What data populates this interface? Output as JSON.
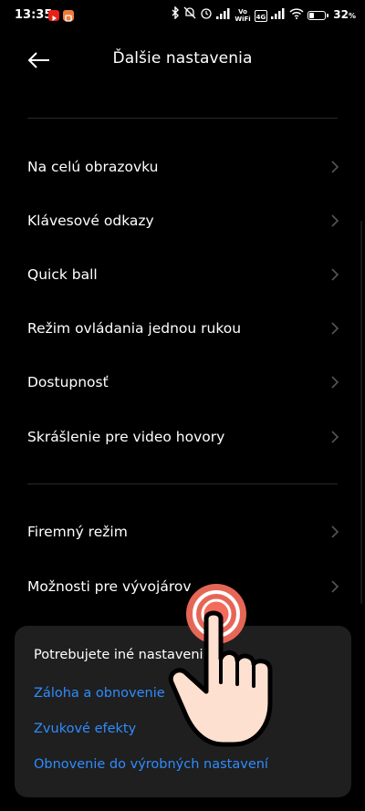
{
  "status_bar": {
    "time": "13:35",
    "network_vo": "Vo",
    "network_wifi": "WiFi",
    "lte_badge": "4G",
    "battery_percent": "32",
    "battery_unit": "%",
    "icons": [
      "youtube-app-icon",
      "app-notification-icon",
      "bluetooth-icon",
      "do-not-disturb-icon",
      "alarm-icon",
      "signal-icon",
      "vowifi-icon",
      "lte-icon",
      "signal-icon",
      "wifi-icon",
      "battery-icon"
    ]
  },
  "header": {
    "title": "Ďalšie nastavenia",
    "back_icon": "back-arrow-icon"
  },
  "list_group_1": {
    "items": [
      {
        "label": "Na celú obrazovku"
      },
      {
        "label": "Klávesové odkazy"
      },
      {
        "label": "Quick ball"
      },
      {
        "label": "Režim ovládania jednou rukou"
      },
      {
        "label": "Dostupnosť"
      },
      {
        "label": "Skrášlenie pre video hovory"
      }
    ]
  },
  "list_group_2": {
    "items": [
      {
        "label": "Firemný režim"
      },
      {
        "label": "Možnosti pre vývojárov"
      }
    ]
  },
  "help_card": {
    "title": "Potrebujete iné nastavenia?",
    "links": [
      {
        "label": "Záloha a obnovenie"
      },
      {
        "label": "Zvukové efekty"
      },
      {
        "label": "Obnovenie do výrobných nastavení"
      }
    ]
  },
  "colors": {
    "background": "#000000",
    "card": "#1f1f1f",
    "link": "#2f8cff",
    "tap_ring": "#f26b5b",
    "hand_fill": "#fde0cf"
  }
}
